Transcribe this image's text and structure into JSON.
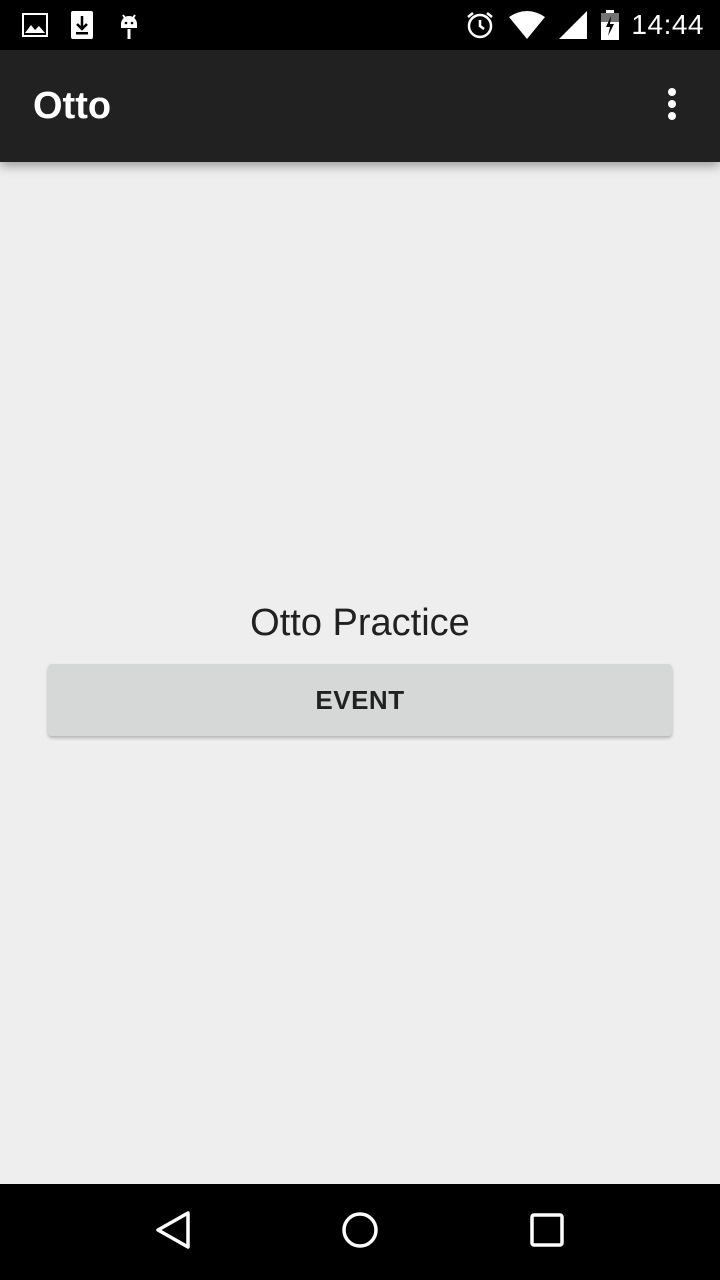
{
  "status_bar": {
    "left_icons": [
      "image-icon",
      "download-icon",
      "android-icon"
    ],
    "right_icons": [
      "alarm-icon",
      "wifi-icon",
      "signal-icon",
      "battery-icon"
    ],
    "time": "14:44"
  },
  "app_bar": {
    "title": "Otto",
    "overflow_icon": "more-vert-icon"
  },
  "main": {
    "heading": "Otto Practice",
    "button_label": "EVENT"
  },
  "nav_bar": {
    "buttons": [
      "back-icon",
      "home-icon",
      "recents-icon"
    ]
  },
  "colors": {
    "status_bar_bg": "#000000",
    "app_bar_bg": "#212121",
    "content_bg": "#eeeeee",
    "button_bg": "#d6d7d7",
    "text_dark": "#212121"
  }
}
